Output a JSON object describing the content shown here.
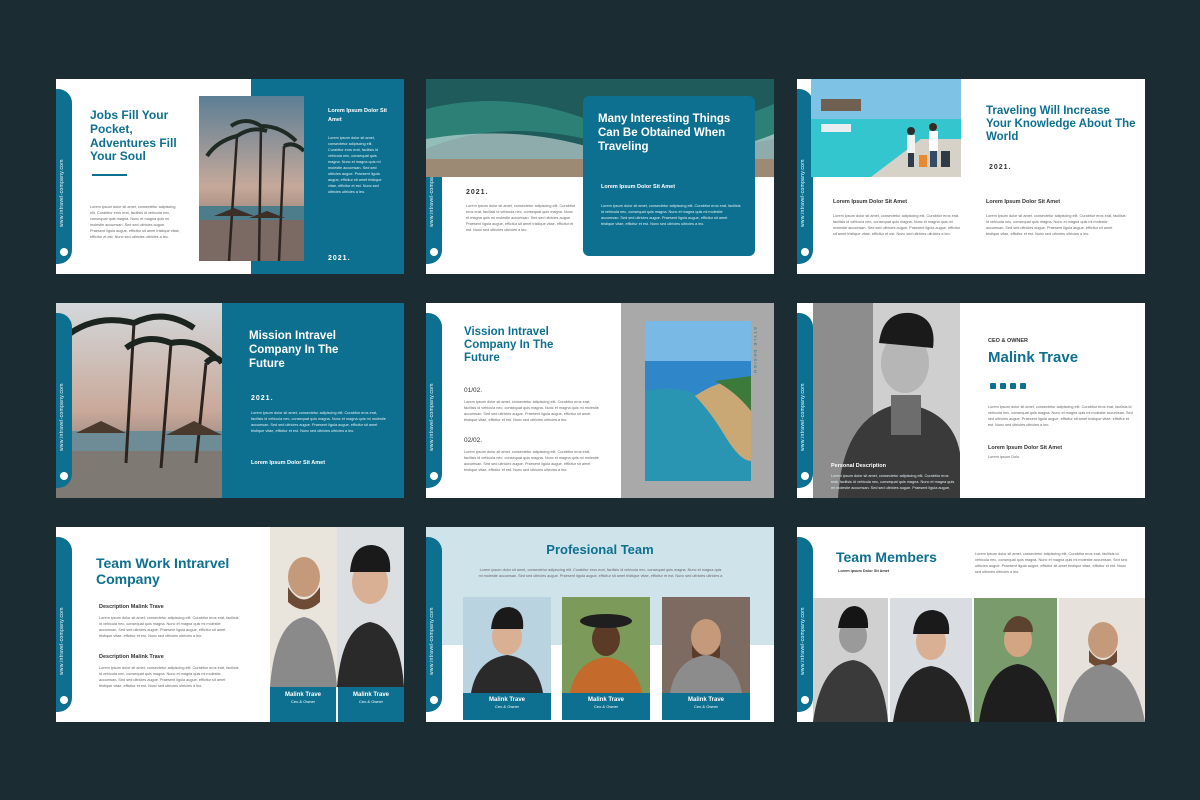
{
  "common": {
    "website": "www.intravel-company.com",
    "lorem": "Lorem ipsum dolor sit amet, consectetur adipiscing elit. Curabitur eros erat, facilisis id vehicula nec, consequat quis magna. Nunc et magna quis mi molestie accumsan. Sed sed ultricies augue. Praesent ligula augue, efficitur sit amet tristique vitae, efficitur et est. Nunc sed ultricies ultricies a leo."
  },
  "slides": [
    {
      "title": "Jobs Fill Your Pocket, Adventures Fill Your Soul",
      "heading": "Lorem Ipsum Dolor Sit Amet",
      "year": "2021."
    },
    {
      "title": "Many Interesting Things Can Be Obtained When Traveling",
      "heading": "Lorem Ipsum Dolor Sit Amet",
      "year": "2021."
    },
    {
      "title": "Traveling Will Increase Your Knowledge About The World",
      "heading": "Lorem Ipsum Dolor Sit Amet",
      "year": "2021."
    },
    {
      "title": "Mission Intravel Company In The Future",
      "heading": "Lorem Ipsum Dolor Sit Amet",
      "year": "2021."
    },
    {
      "title": "Vission Intravel Company In The Future",
      "num1": "01/02.",
      "num2": "02/02.",
      "side_text": "STYLE DESIGN"
    },
    {
      "role": "CEO & OWNER",
      "name": "Malink Trave",
      "heading": "Lorem Ipsum Dolor Sit Amet",
      "sub": "Lorem Ipsum Dolo",
      "caption": "Personal Description"
    },
    {
      "title": "Team Work Intrarvel Company",
      "desc": "Description Malink Trave",
      "card_name": "Malink Trave",
      "card_role": "Ceo & Owner"
    },
    {
      "title": "Profesional Team",
      "card_name": "Malink Trave",
      "card_role": "Ceo & Owner"
    },
    {
      "title": "Team Members",
      "sub": "Lorem Ipsum Dolor Sit Amet"
    }
  ],
  "colors": {
    "background": "#1b2c33",
    "accent": "#0e7090",
    "slide": "#ffffff"
  },
  "icons": [
    "instagram-icon",
    "twitter-icon",
    "facebook-icon",
    "pinterest-icon"
  ]
}
